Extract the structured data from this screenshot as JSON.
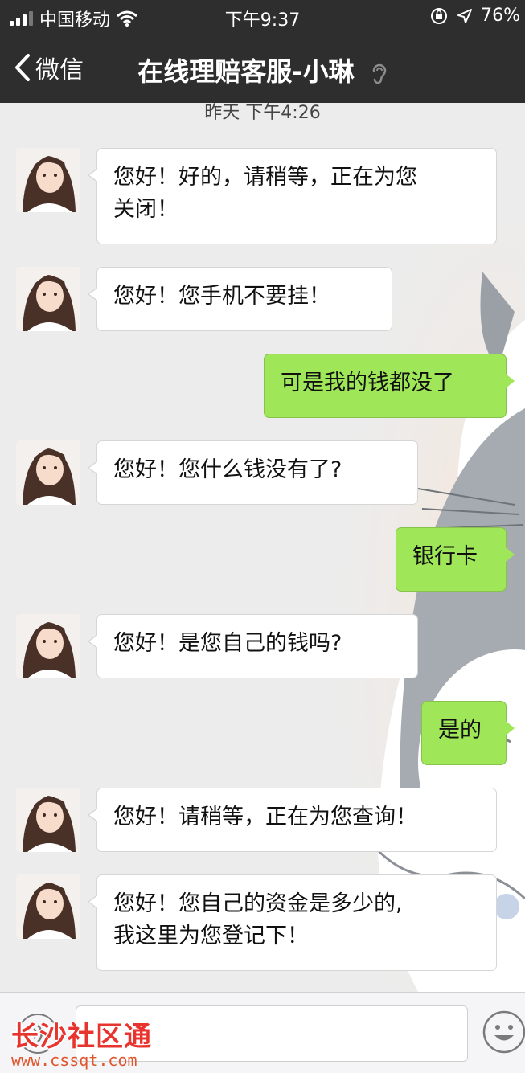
{
  "status_bar": {
    "carrier": "中国移动",
    "time": "下午9:37",
    "battery": "76%"
  },
  "nav": {
    "back_label": "微信",
    "title": "在线理赔客服-小琳"
  },
  "chat": {
    "timestamp": "昨天 下午4:26",
    "messages": [
      {
        "from": "agent",
        "line1": "您好！好的，请稍等，正在为您",
        "line2": "关闭！"
      },
      {
        "from": "agent",
        "line1": "您好！您手机不要挂！"
      },
      {
        "from": "me",
        "line1": "可是我的钱都没了"
      },
      {
        "from": "agent",
        "line1": "您好！您什么钱没有了?"
      },
      {
        "from": "me",
        "line1": "银行卡"
      },
      {
        "from": "agent",
        "line1": "您好！是您自己的钱吗?"
      },
      {
        "from": "me",
        "line1": "是的"
      },
      {
        "from": "agent",
        "line1": "您好！请稍等，正在为您查询！"
      },
      {
        "from": "agent",
        "line1": "您好！您自己的资金是多少的,",
        "line2": "我这里为您登记下！"
      }
    ]
  },
  "watermark": {
    "name": "长沙社区通",
    "url": "www.cssqt.com"
  },
  "colors": {
    "header_bg": "#2e2e2e",
    "outgoing_bubble": "#9fe658",
    "incoming_bubble": "#ffffff",
    "chat_bg": "#ececec"
  },
  "icons": [
    "wifi-icon",
    "orientation-lock-icon",
    "location-arrow-icon",
    "back-chevron-icon",
    "ear-icon",
    "voice-icon",
    "emoji-icon"
  ]
}
